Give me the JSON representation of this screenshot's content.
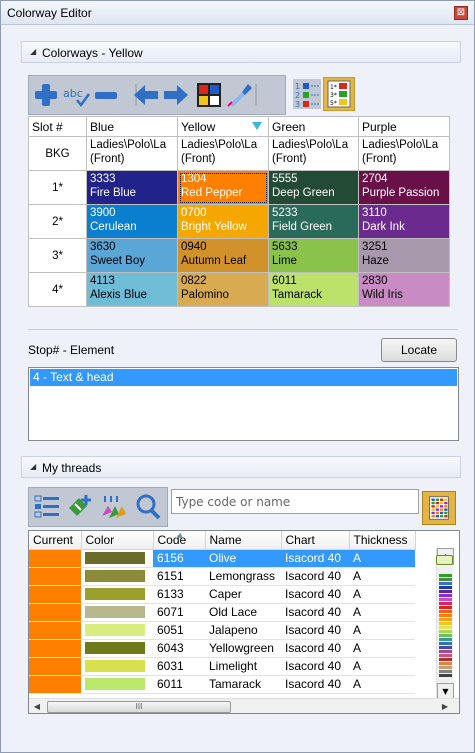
{
  "window": {
    "title": "Colorway Editor",
    "close_glyph": "⊠"
  },
  "colorways": {
    "header": "Colorways - Yellow",
    "columns": [
      "Slot #",
      "Blue",
      "Yellow",
      "Green",
      "Purple"
    ],
    "rows": [
      {
        "slot": "BKG",
        "cells": [
          {
            "code": "Ladies\\Polo\\La",
            "name": "(Front)",
            "bg": "#ffffff",
            "fg": "#000000"
          },
          {
            "code": "Ladies\\Polo\\La",
            "name": "(Front)",
            "bg": "#ffffff",
            "fg": "#000000"
          },
          {
            "code": "Ladies\\Polo\\La",
            "name": "(Front)",
            "bg": "#ffffff",
            "fg": "#000000"
          },
          {
            "code": "Ladies\\Polo\\La",
            "name": "(Front)",
            "bg": "#ffffff",
            "fg": "#000000"
          }
        ]
      },
      {
        "slot": "1*",
        "cells": [
          {
            "code": "3333",
            "name": "Fire Blue",
            "bg": "#22238a",
            "fg": "#ffffff"
          },
          {
            "code": "1304",
            "name": "Red Pepper",
            "bg": "#ff7f00",
            "fg": "#ffffff",
            "selected": true
          },
          {
            "code": "5555",
            "name": "Deep Green",
            "bg": "#234a34",
            "fg": "#ffffff"
          },
          {
            "code": "2704",
            "name": "Purple Passion",
            "bg": "#6a1048",
            "fg": "#ffffff"
          }
        ]
      },
      {
        "slot": "2*",
        "cells": [
          {
            "code": "3900",
            "name": "Cerulean",
            "bg": "#0a7fd0",
            "fg": "#ffffff"
          },
          {
            "code": "0700",
            "name": "Bright Yellow",
            "bg": "#f5a700",
            "fg": "#ffffff"
          },
          {
            "code": "5233",
            "name": "Field Green",
            "bg": "#2a6a5a",
            "fg": "#ffffff"
          },
          {
            "code": "3110",
            "name": "Dark Ink",
            "bg": "#6a2a8e",
            "fg": "#ffffff"
          }
        ]
      },
      {
        "slot": "3*",
        "cells": [
          {
            "code": "3630",
            "name": "Sweet Boy",
            "bg": "#5aa6d6",
            "fg": "#000000"
          },
          {
            "code": "0940",
            "name": "Autumn Leaf",
            "bg": "#d1922c",
            "fg": "#000000"
          },
          {
            "code": "5633",
            "name": "Lime",
            "bg": "#8bc34a",
            "fg": "#000000"
          },
          {
            "code": "3251",
            "name": "Haze",
            "bg": "#a89aac",
            "fg": "#000000"
          }
        ]
      },
      {
        "slot": "4*",
        "cells": [
          {
            "code": "4113",
            "name": "Alexis Blue",
            "bg": "#6fbcd6",
            "fg": "#000000"
          },
          {
            "code": "0822",
            "name": "Palomino",
            "bg": "#d8ab52",
            "fg": "#000000"
          },
          {
            "code": "6011",
            "name": "Tamarack",
            "bg": "#bde26c",
            "fg": "#000000"
          },
          {
            "code": "2830",
            "name": "Wild Iris",
            "bg": "#c88bc4",
            "fg": "#000000"
          }
        ]
      }
    ]
  },
  "stops": {
    "label": "Stop# - Element",
    "locate_label": "Locate",
    "items": [
      "4 - Text & head"
    ]
  },
  "threads": {
    "header": "My threads",
    "search_placeholder": "Type code or name",
    "columns": [
      "Current",
      "Color",
      "Code",
      "Name",
      "Chart",
      "Thickness"
    ],
    "current_color": "#ff7f00",
    "rows": [
      {
        "color": "#6b6b2a",
        "code": "6156",
        "name": "Olive",
        "chart": "Isacord 40",
        "thickness": "A",
        "selected": true
      },
      {
        "color": "#8a8a38",
        "code": "6151",
        "name": "Lemongrass",
        "chart": "Isacord 40",
        "thickness": "A"
      },
      {
        "color": "#9aa02c",
        "code": "6133",
        "name": "Caper",
        "chart": "Isacord 40",
        "thickness": "A"
      },
      {
        "color": "#b8b88e",
        "code": "6071",
        "name": "Old Lace",
        "chart": "Isacord 40",
        "thickness": "A"
      },
      {
        "color": "#d9ec80",
        "code": "6051",
        "name": "Jalapeno",
        "chart": "Isacord 40",
        "thickness": "A"
      },
      {
        "color": "#6c7a18",
        "code": "6043",
        "name": "Yellowgreen",
        "chart": "Isacord 40",
        "thickness": "A"
      },
      {
        "color": "#d9e04e",
        "code": "6031",
        "name": "Limelight",
        "chart": "Isacord 40",
        "thickness": "A"
      },
      {
        "color": "#b9e86a",
        "code": "6011",
        "name": "Tamarack",
        "chart": "Isacord 40",
        "thickness": "A"
      }
    ],
    "hscroll_grip": "III"
  },
  "icons": {
    "toolbar1": [
      "add-icon",
      "spell-check-icon",
      "remove-icon",
      "arrow-left-icon",
      "arrow-right-icon",
      "color-grid-icon",
      "eyedropper-icon",
      "numbered-list-icon",
      "palette-swap-icon"
    ],
    "toolbar2": [
      "checklist-icon",
      "add-thread-icon",
      "thread-spools-icon",
      "search-icon"
    ],
    "palette": "thread-palette-icon"
  }
}
